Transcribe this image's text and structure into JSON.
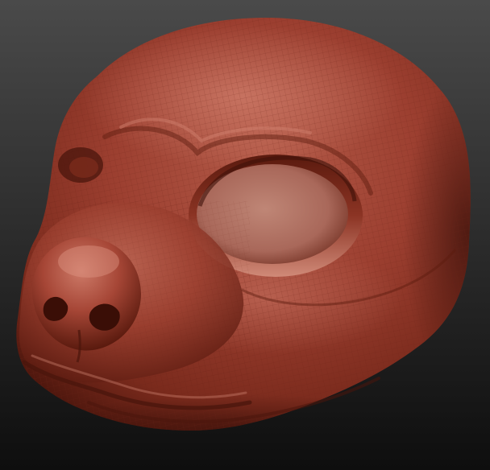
{
  "scene": {
    "subject": "sculpted-animal-head",
    "material": "red-clay",
    "features": [
      "cranium",
      "eye-socket-right",
      "eye-socket-left",
      "snout",
      "nose",
      "nostril-left",
      "nostril-right",
      "upper-lip",
      "lower-jaw"
    ]
  },
  "colors": {
    "background_top": "#4a4a4a",
    "background_bottom": "#0e0e0e",
    "clay_highlight": "#c77262",
    "clay_base": "#9c3f30",
    "clay_mid": "#82301f",
    "clay_shadow": "#4a150c",
    "clay_deep": "#2a0a05",
    "eye_socket_inner": "#b87a6c",
    "wireframe": "#6e2418"
  }
}
